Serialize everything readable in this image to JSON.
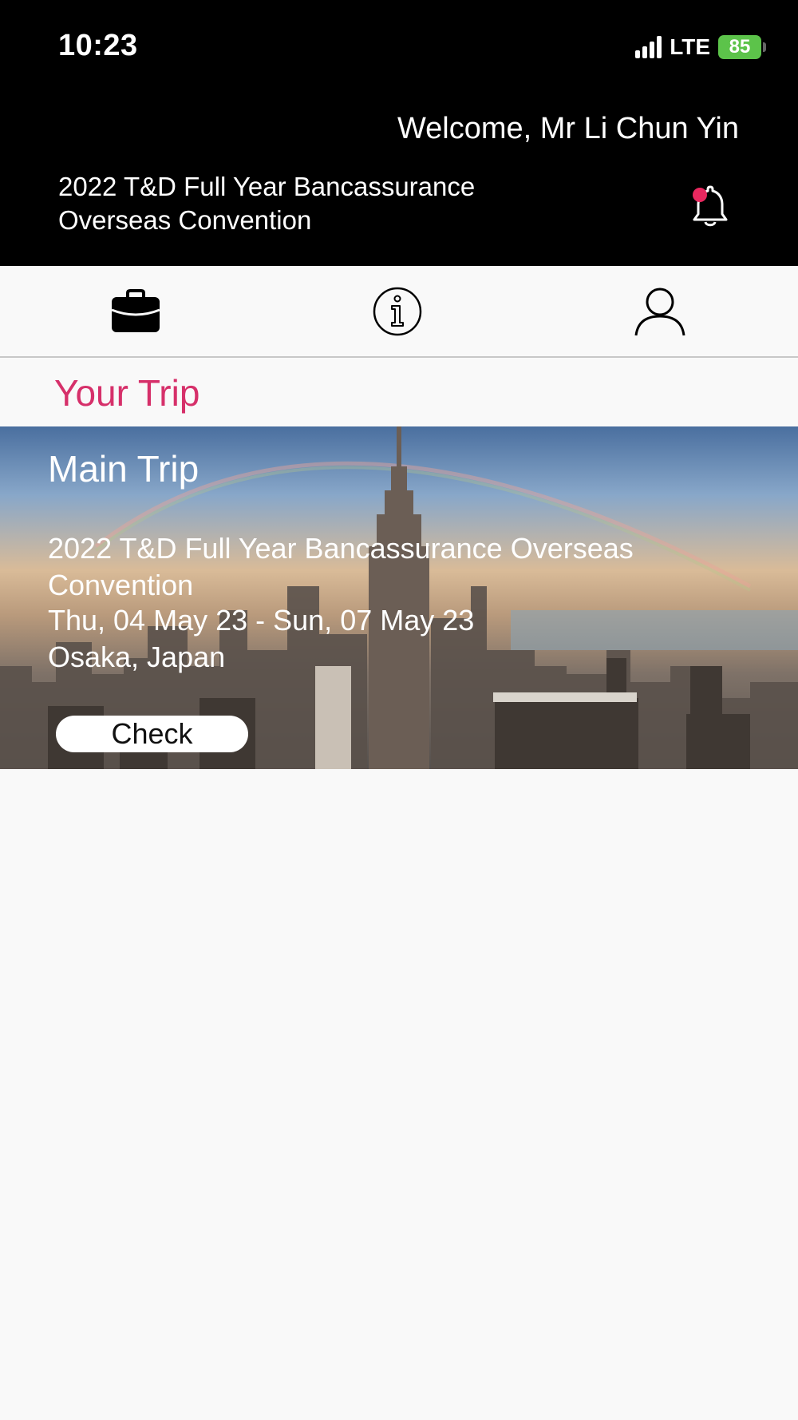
{
  "status_bar": {
    "time": "10:23",
    "network": "LTE",
    "battery": "85"
  },
  "header": {
    "welcome": "Welcome, Mr Li Chun Yin",
    "event_title": "2022 T&D Full Year Bancassurance Overseas Convention"
  },
  "tabs": [
    {
      "icon": "briefcase-icon"
    },
    {
      "icon": "info-icon"
    },
    {
      "icon": "user-icon"
    }
  ],
  "section": {
    "title": "Your Trip"
  },
  "trip": {
    "label": "Main Trip",
    "name": "2022 T&D Full Year Bancassurance Overseas Convention",
    "dates": "Thu, 04 May 23 - Sun, 07 May 23",
    "location": "Osaka, Japan",
    "button": "Check"
  },
  "colors": {
    "accent": "#d6306a",
    "header_bg": "#000000",
    "page_bg": "#f9f9f9",
    "battery": "#5cc34a",
    "notification_dot": "#e8285f"
  }
}
